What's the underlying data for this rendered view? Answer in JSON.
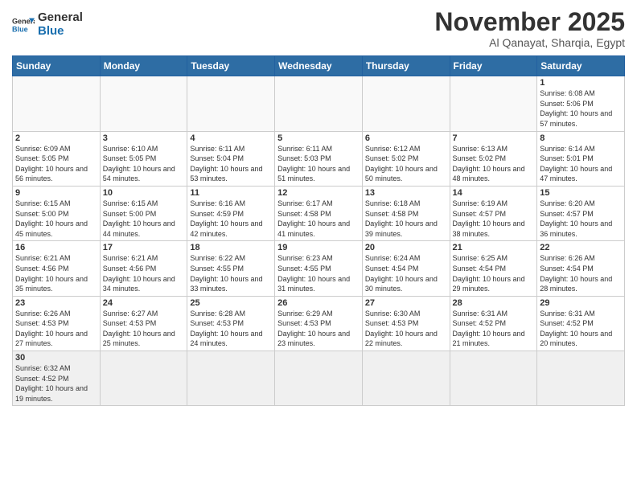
{
  "logo": {
    "text_general": "General",
    "text_blue": "Blue"
  },
  "title": "November 2025",
  "subtitle": "Al Qanayat, Sharqia, Egypt",
  "weekdays": [
    "Sunday",
    "Monday",
    "Tuesday",
    "Wednesday",
    "Thursday",
    "Friday",
    "Saturday"
  ],
  "weeks": [
    [
      {
        "day": "",
        "info": ""
      },
      {
        "day": "",
        "info": ""
      },
      {
        "day": "",
        "info": ""
      },
      {
        "day": "",
        "info": ""
      },
      {
        "day": "",
        "info": ""
      },
      {
        "day": "",
        "info": ""
      },
      {
        "day": "1",
        "info": "Sunrise: 6:08 AM\nSunset: 5:06 PM\nDaylight: 10 hours and 57 minutes."
      }
    ],
    [
      {
        "day": "2",
        "info": "Sunrise: 6:09 AM\nSunset: 5:05 PM\nDaylight: 10 hours and 56 minutes."
      },
      {
        "day": "3",
        "info": "Sunrise: 6:10 AM\nSunset: 5:05 PM\nDaylight: 10 hours and 54 minutes."
      },
      {
        "day": "4",
        "info": "Sunrise: 6:11 AM\nSunset: 5:04 PM\nDaylight: 10 hours and 53 minutes."
      },
      {
        "day": "5",
        "info": "Sunrise: 6:11 AM\nSunset: 5:03 PM\nDaylight: 10 hours and 51 minutes."
      },
      {
        "day": "6",
        "info": "Sunrise: 6:12 AM\nSunset: 5:02 PM\nDaylight: 10 hours and 50 minutes."
      },
      {
        "day": "7",
        "info": "Sunrise: 6:13 AM\nSunset: 5:02 PM\nDaylight: 10 hours and 48 minutes."
      },
      {
        "day": "8",
        "info": "Sunrise: 6:14 AM\nSunset: 5:01 PM\nDaylight: 10 hours and 47 minutes."
      }
    ],
    [
      {
        "day": "9",
        "info": "Sunrise: 6:15 AM\nSunset: 5:00 PM\nDaylight: 10 hours and 45 minutes."
      },
      {
        "day": "10",
        "info": "Sunrise: 6:15 AM\nSunset: 5:00 PM\nDaylight: 10 hours and 44 minutes."
      },
      {
        "day": "11",
        "info": "Sunrise: 6:16 AM\nSunset: 4:59 PM\nDaylight: 10 hours and 42 minutes."
      },
      {
        "day": "12",
        "info": "Sunrise: 6:17 AM\nSunset: 4:58 PM\nDaylight: 10 hours and 41 minutes."
      },
      {
        "day": "13",
        "info": "Sunrise: 6:18 AM\nSunset: 4:58 PM\nDaylight: 10 hours and 39 minutes."
      },
      {
        "day": "14",
        "info": "Sunrise: 6:19 AM\nSunset: 4:57 PM\nDaylight: 10 hours and 38 minutes."
      },
      {
        "day": "15",
        "info": "Sunrise: 6:20 AM\nSunset: 4:57 PM\nDaylight: 10 hours and 36 minutes."
      }
    ],
    [
      {
        "day": "16",
        "info": "Sunrise: 6:21 AM\nSunset: 4:56 PM\nDaylight: 10 hours and 35 minutes."
      },
      {
        "day": "17",
        "info": "Sunrise: 6:21 AM\nSunset: 4:56 PM\nDaylight: 10 hours and 34 minutes."
      },
      {
        "day": "18",
        "info": "Sunrise: 6:22 AM\nSunset: 4:55 PM\nDaylight: 10 hours and 33 minutes."
      },
      {
        "day": "19",
        "info": "Sunrise: 6:23 AM\nSunset: 4:55 PM\nDaylight: 10 hours and 31 minutes."
      },
      {
        "day": "20",
        "info": "Sunrise: 6:24 AM\nSunset: 4:54 PM\nDaylight: 10 hours and 30 minutes."
      },
      {
        "day": "21",
        "info": "Sunrise: 6:25 AM\nSunset: 4:54 PM\nDaylight: 10 hours and 29 minutes."
      },
      {
        "day": "22",
        "info": "Sunrise: 6:26 AM\nSunset: 4:54 PM\nDaylight: 10 hours and 28 minutes."
      }
    ],
    [
      {
        "day": "23",
        "info": "Sunrise: 6:26 AM\nSunset: 4:53 PM\nDaylight: 10 hours and 27 minutes."
      },
      {
        "day": "24",
        "info": "Sunrise: 6:27 AM\nSunset: 4:53 PM\nDaylight: 10 hours and 25 minutes."
      },
      {
        "day": "25",
        "info": "Sunrise: 6:28 AM\nSunset: 4:53 PM\nDaylight: 10 hours and 24 minutes."
      },
      {
        "day": "26",
        "info": "Sunrise: 6:29 AM\nSunset: 4:53 PM\nDaylight: 10 hours and 23 minutes."
      },
      {
        "day": "27",
        "info": "Sunrise: 6:30 AM\nSunset: 4:53 PM\nDaylight: 10 hours and 22 minutes."
      },
      {
        "day": "28",
        "info": "Sunrise: 6:31 AM\nSunset: 4:52 PM\nDaylight: 10 hours and 21 minutes."
      },
      {
        "day": "29",
        "info": "Sunrise: 6:31 AM\nSunset: 4:52 PM\nDaylight: 10 hours and 20 minutes."
      }
    ],
    [
      {
        "day": "30",
        "info": "Sunrise: 6:32 AM\nSunset: 4:52 PM\nDaylight: 10 hours and 19 minutes."
      },
      {
        "day": "",
        "info": ""
      },
      {
        "day": "",
        "info": ""
      },
      {
        "day": "",
        "info": ""
      },
      {
        "day": "",
        "info": ""
      },
      {
        "day": "",
        "info": ""
      },
      {
        "day": "",
        "info": ""
      }
    ]
  ]
}
